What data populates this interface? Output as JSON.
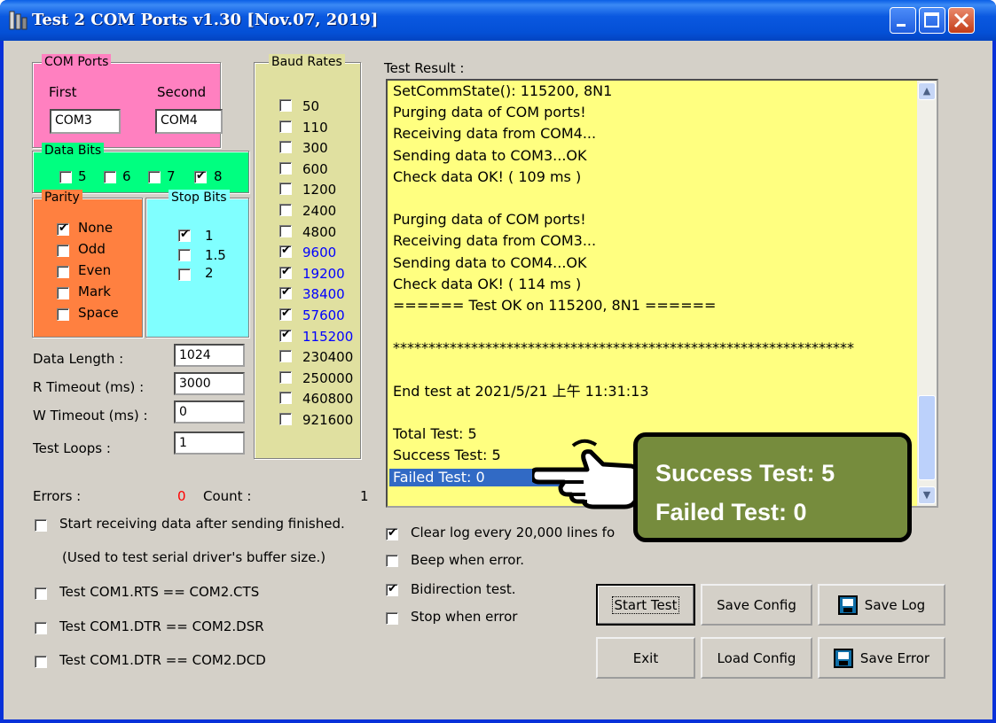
{
  "window": {
    "title": "Test 2 COM Ports v1.30 [Nov.07, 2019]"
  },
  "com_ports": {
    "label": "COM Ports",
    "first_label": "First",
    "second_label": "Second",
    "first_value": "COM3",
    "second_value": "COM4"
  },
  "data_bits": {
    "label": "Data Bits",
    "options": [
      {
        "label": "5",
        "checked": false
      },
      {
        "label": "6",
        "checked": false
      },
      {
        "label": "7",
        "checked": false
      },
      {
        "label": "8",
        "checked": true
      }
    ]
  },
  "parity": {
    "label": "Parity",
    "options": [
      {
        "label": "None",
        "checked": true
      },
      {
        "label": "Odd",
        "checked": false
      },
      {
        "label": "Even",
        "checked": false
      },
      {
        "label": "Mark",
        "checked": false
      },
      {
        "label": "Space",
        "checked": false
      }
    ]
  },
  "stop_bits": {
    "label": "Stop Bits",
    "options": [
      {
        "label": "1",
        "checked": true
      },
      {
        "label": "1.5",
        "checked": false
      },
      {
        "label": "2",
        "checked": false
      }
    ]
  },
  "baud_rates": {
    "label": "Baud Rates",
    "options": [
      {
        "label": "50",
        "checked": false
      },
      {
        "label": "110",
        "checked": false
      },
      {
        "label": "300",
        "checked": false
      },
      {
        "label": "600",
        "checked": false
      },
      {
        "label": "1200",
        "checked": false
      },
      {
        "label": "2400",
        "checked": false
      },
      {
        "label": "4800",
        "checked": false
      },
      {
        "label": "9600",
        "checked": true
      },
      {
        "label": "19200",
        "checked": true
      },
      {
        "label": "38400",
        "checked": true
      },
      {
        "label": "57600",
        "checked": true
      },
      {
        "label": "115200",
        "checked": true
      },
      {
        "label": "230400",
        "checked": false
      },
      {
        "label": "250000",
        "checked": false
      },
      {
        "label": "460800",
        "checked": false
      },
      {
        "label": "921600",
        "checked": false
      }
    ]
  },
  "settings": {
    "data_length_label": "Data Length :",
    "data_length": "1024",
    "r_timeout_label": "R Timeout (ms) :",
    "r_timeout": "3000",
    "w_timeout_label": "W Timeout (ms) :",
    "w_timeout": "0",
    "test_loops_label": "Test Loops :",
    "test_loops": "1"
  },
  "errors": {
    "label": "Errors :",
    "value": "0",
    "count_label": "Count :",
    "count_value": "1"
  },
  "options_left": {
    "start_receiving": "Start receiving data after sending finished.",
    "buffer_note": "(Used to test serial driver's buffer size.)",
    "rts_cts": "Test COM1.RTS == COM2.CTS",
    "dtr_dsr": "Test COM1.DTR == COM2.DSR",
    "dtr_dcd": "Test COM1.DTR == COM2.DCD"
  },
  "options_right": {
    "clear_log": "Clear log every 20,000  lines fo",
    "beep": "Beep when error.",
    "bidirection": "Bidirection test.",
    "stop_error": "Stop when error"
  },
  "test_result": {
    "label": "Test Result :",
    "lines": [
      "SetCommState(): 115200, 8N1",
      "Purging data of COM ports!",
      "Receiving data from COM4...",
      "Sending data to COM3...OK",
      "Check data OK! ( 109 ms )",
      "",
      "Purging data of COM ports!",
      "Receiving data from COM3...",
      "Sending data to COM4...OK",
      "Check data OK! ( 114 ms )",
      "====== Test OK on 115200, 8N1 ======",
      "",
      "*****************************************************************",
      "",
      "End test at 2021/5/21 上午 11:31:13",
      "",
      "Total Test: 5",
      "Success Test: 5",
      "Failed Test: 0"
    ]
  },
  "buttons": {
    "start_test": "Start Test",
    "save_config": "Save Config",
    "save_log": "Save Log",
    "exit": "Exit",
    "load_config": "Load Config",
    "save_error": "Save Error"
  },
  "callout": {
    "line1": "Success Test: 5",
    "line2": "Failed Test: 0"
  },
  "colors": {
    "com_ports_bg": "#ff80c0",
    "data_bits_bg": "#00ff80",
    "parity_bg": "#ff8040",
    "stop_bits_bg": "#80ffff",
    "baud_bg": "#e0e0a0",
    "log_bg": "#ffff80",
    "callout_bg": "#768c3d"
  }
}
